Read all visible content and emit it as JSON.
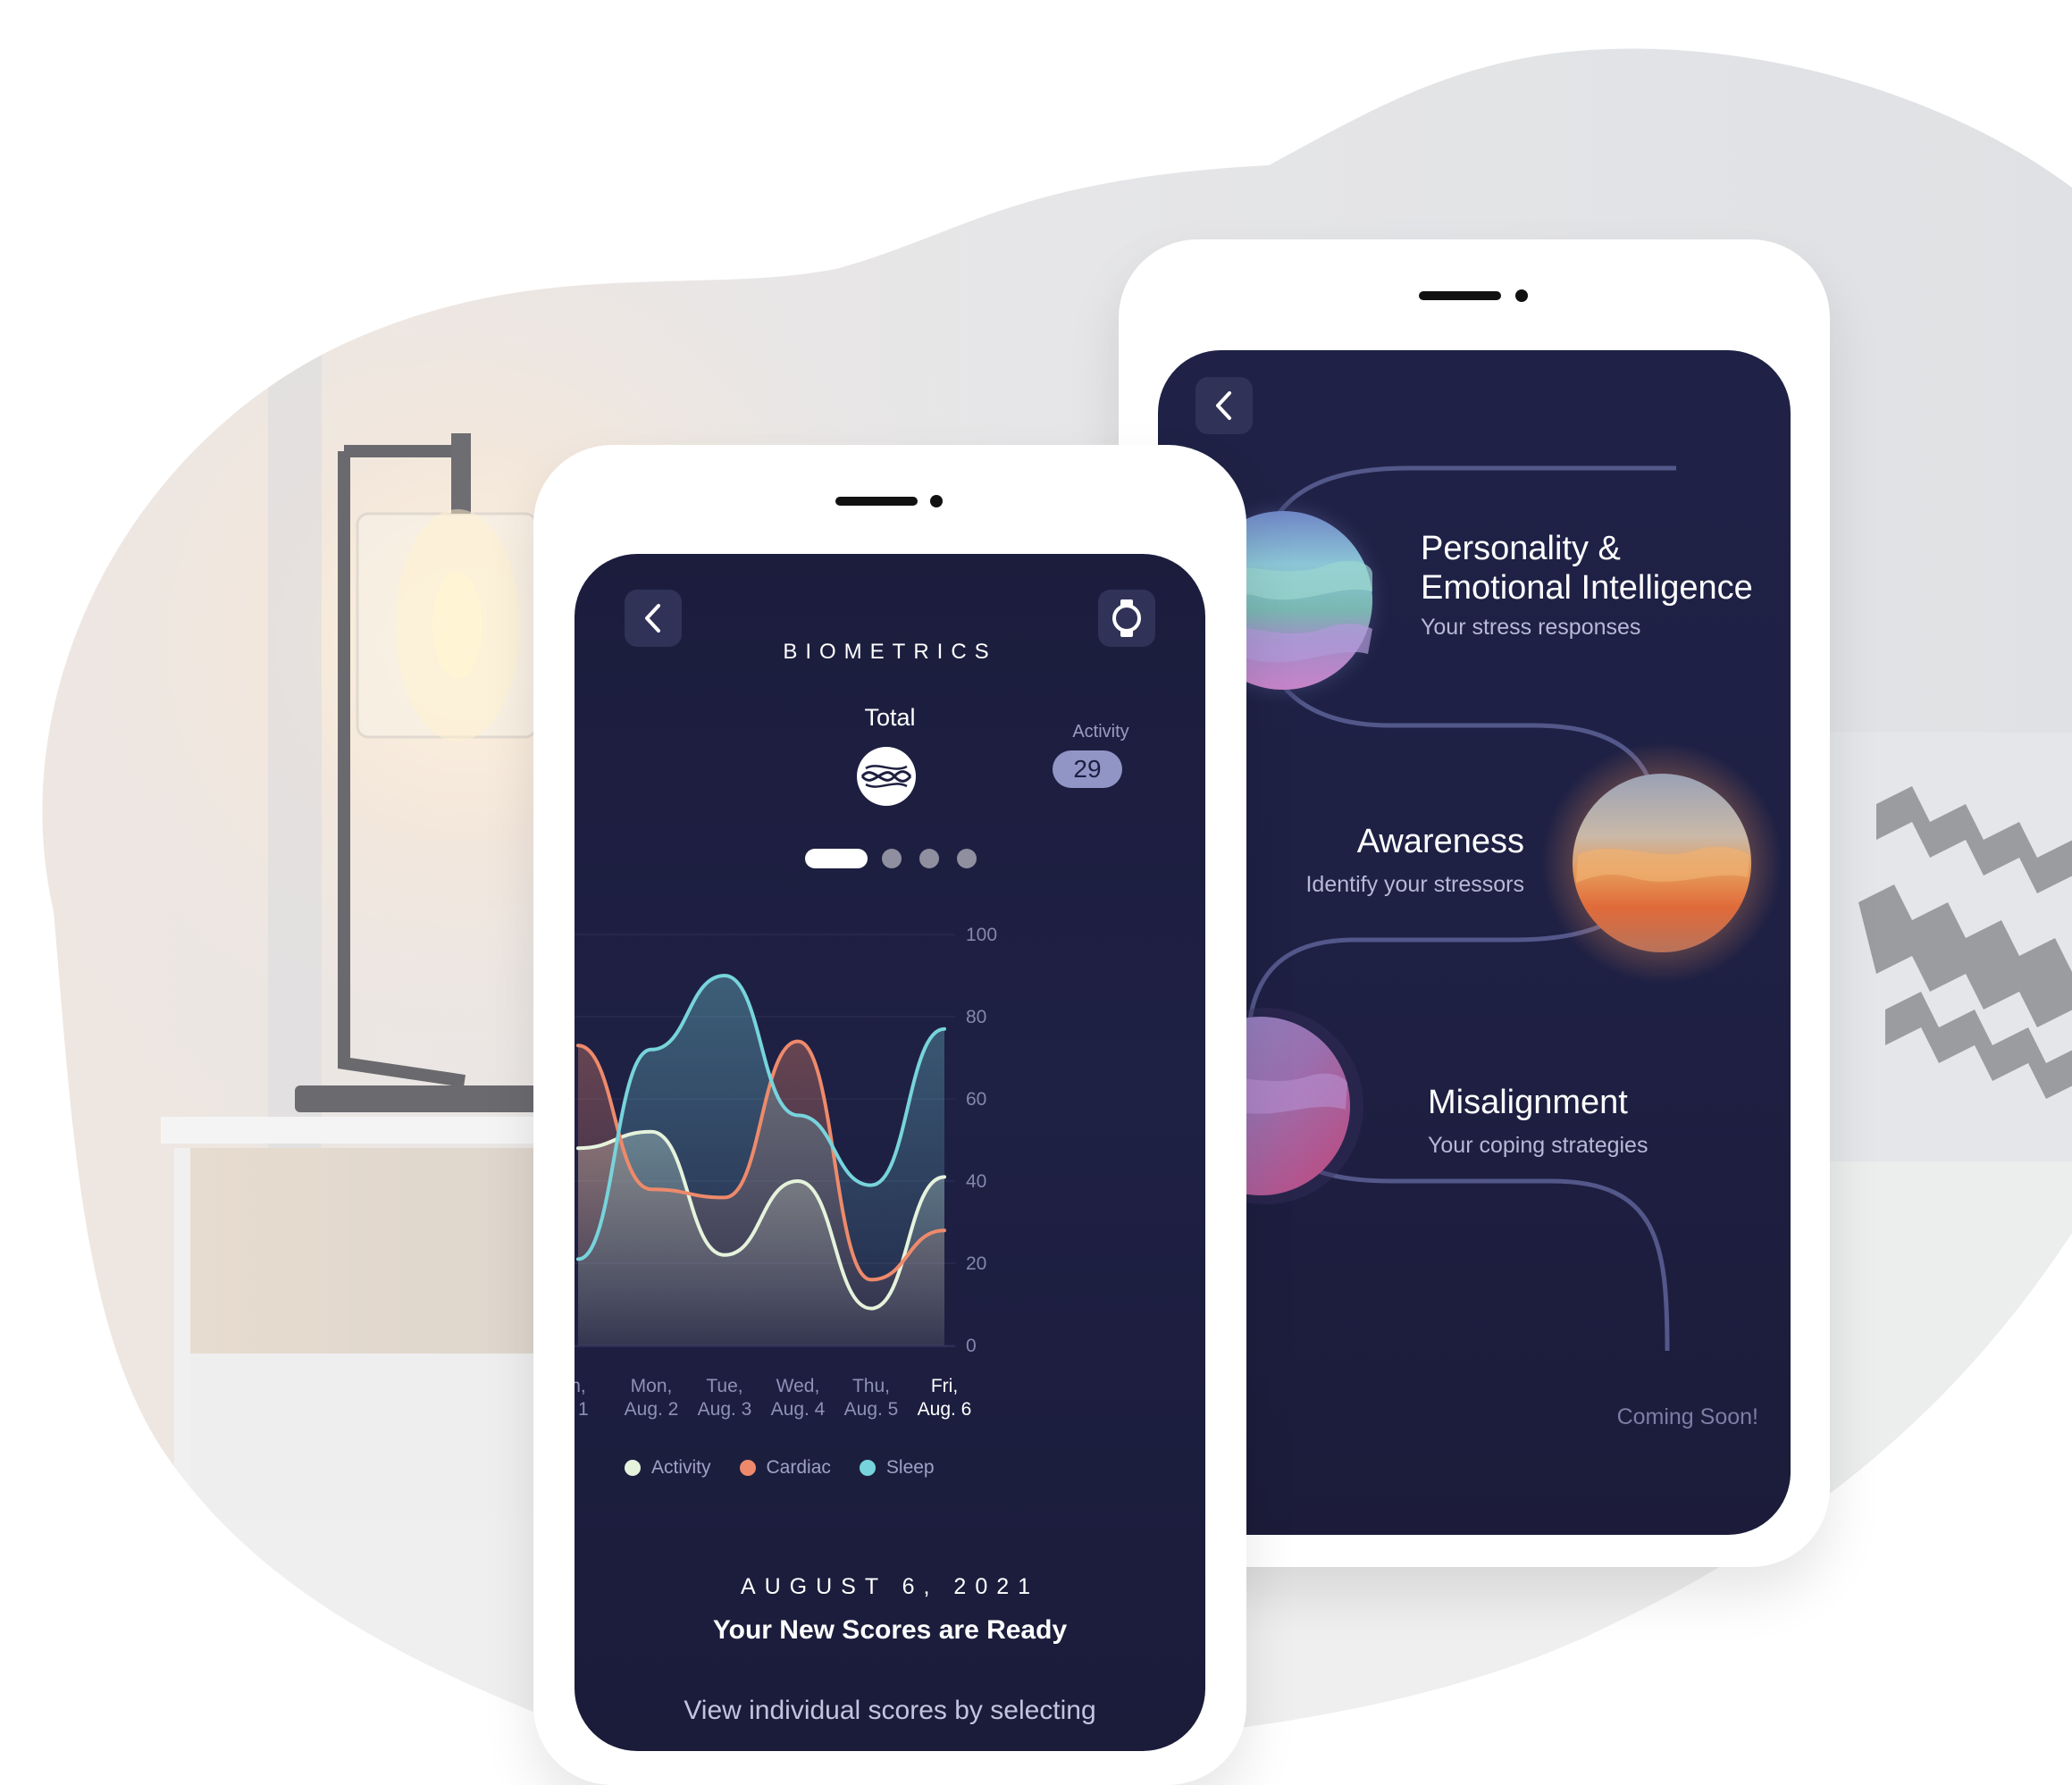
{
  "biometrics_screen": {
    "title": "BIOMETRICS",
    "total_label": "Total",
    "activity_label": "Activity",
    "activity_value": "29",
    "back_icon": "chevron-left-icon",
    "watch_icon": "watch-icon",
    "pager_dots": 4,
    "pager_active_index": 0,
    "legend": [
      {
        "label": "Activity",
        "color": "#e6f3dc"
      },
      {
        "label": "Cardiac",
        "color": "#ee8a6b"
      },
      {
        "label": "Sleep",
        "color": "#77d4dc"
      }
    ],
    "date": "AUGUST 6, 2021",
    "headline": "Your New Scores are Ready",
    "body_text": "View individual scores by selecting"
  },
  "chart_data": {
    "type": "area",
    "y_ticks": [
      "100",
      "80",
      "60",
      "40",
      "20",
      "0"
    ],
    "ylim": [
      0,
      100
    ],
    "x_labels": [
      {
        "line1": "n,",
        "line2": ". 1",
        "bold": false
      },
      {
        "line1": "Mon,",
        "line2": "Aug. 2",
        "bold": false
      },
      {
        "line1": "Tue,",
        "line2": "Aug. 3",
        "bold": false
      },
      {
        "line1": "Wed,",
        "line2": "Aug. 4",
        "bold": false
      },
      {
        "line1": "Thu,",
        "line2": "Aug. 5",
        "bold": false
      },
      {
        "line1": "Fri,",
        "line2": "Aug. 6",
        "bold": true
      }
    ],
    "series": [
      {
        "name": "Activity",
        "color": "#e6f3dc",
        "values": [
          48,
          52,
          22,
          40,
          9,
          41
        ]
      },
      {
        "name": "Cardiac",
        "color": "#ee8a6b",
        "values": [
          73,
          38,
          36,
          74,
          16,
          28
        ]
      },
      {
        "name": "Sleep",
        "color": "#77d4dc",
        "values": [
          21,
          72,
          90,
          56,
          39,
          77
        ]
      }
    ]
  },
  "journey_screen": {
    "back_icon": "chevron-left-icon",
    "items": [
      {
        "title_line1": "Personality &",
        "title_line2": "Emotional Intelligence",
        "subtitle": "Your stress responses"
      },
      {
        "title_line1": "Awareness",
        "title_line2": "",
        "subtitle": "Identify your stressors"
      },
      {
        "title_line1": "Misalignment",
        "title_line2": "",
        "subtitle": "Your coping strategies"
      }
    ],
    "coming_soon": "Coming Soon!"
  }
}
